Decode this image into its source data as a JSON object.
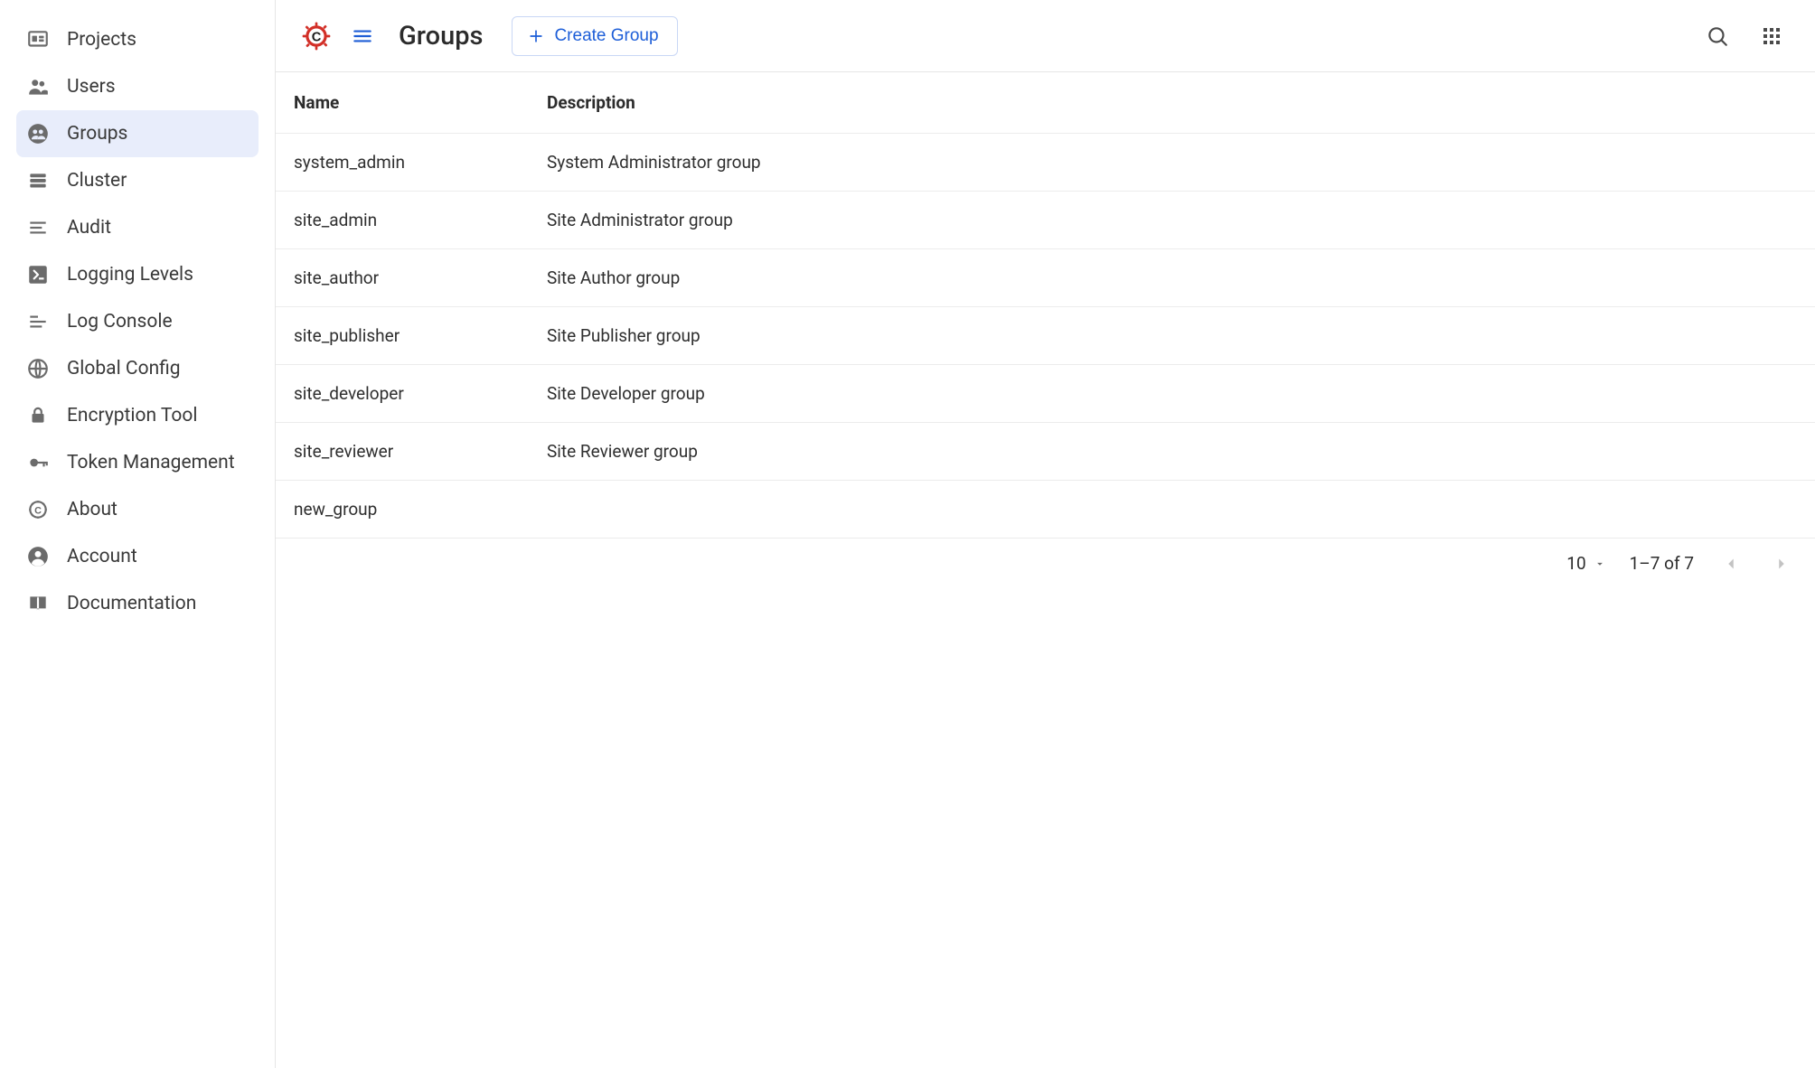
{
  "sidebar": {
    "items": [
      {
        "label": "Projects",
        "icon": "projects"
      },
      {
        "label": "Users",
        "icon": "users"
      },
      {
        "label": "Groups",
        "icon": "groups",
        "active": true
      },
      {
        "label": "Cluster",
        "icon": "cluster"
      },
      {
        "label": "Audit",
        "icon": "audit"
      },
      {
        "label": "Logging Levels",
        "icon": "logging-levels"
      },
      {
        "label": "Log Console",
        "icon": "log-console"
      },
      {
        "label": "Global Config",
        "icon": "global-config"
      },
      {
        "label": "Encryption Tool",
        "icon": "encryption"
      },
      {
        "label": "Token Management",
        "icon": "token"
      },
      {
        "label": "About",
        "icon": "about"
      },
      {
        "label": "Account",
        "icon": "account"
      },
      {
        "label": "Documentation",
        "icon": "documentation"
      }
    ]
  },
  "header": {
    "title": "Groups",
    "create_label": "Create Group"
  },
  "table": {
    "columns": {
      "name": "Name",
      "description": "Description"
    },
    "rows": [
      {
        "name": "system_admin",
        "description": "System Administrator group"
      },
      {
        "name": "site_admin",
        "description": "Site Administrator group"
      },
      {
        "name": "site_author",
        "description": "Site Author group"
      },
      {
        "name": "site_publisher",
        "description": "Site Publisher group"
      },
      {
        "name": "site_developer",
        "description": "Site Developer group"
      },
      {
        "name": "site_reviewer",
        "description": "Site Reviewer group"
      },
      {
        "name": "new_group",
        "description": ""
      }
    ]
  },
  "pagination": {
    "page_size": "10",
    "range": "1–7 of 7"
  },
  "colors": {
    "accent": "#1d5ed8",
    "active_bg": "#e8edfb",
    "brand_red": "#d22f27"
  }
}
